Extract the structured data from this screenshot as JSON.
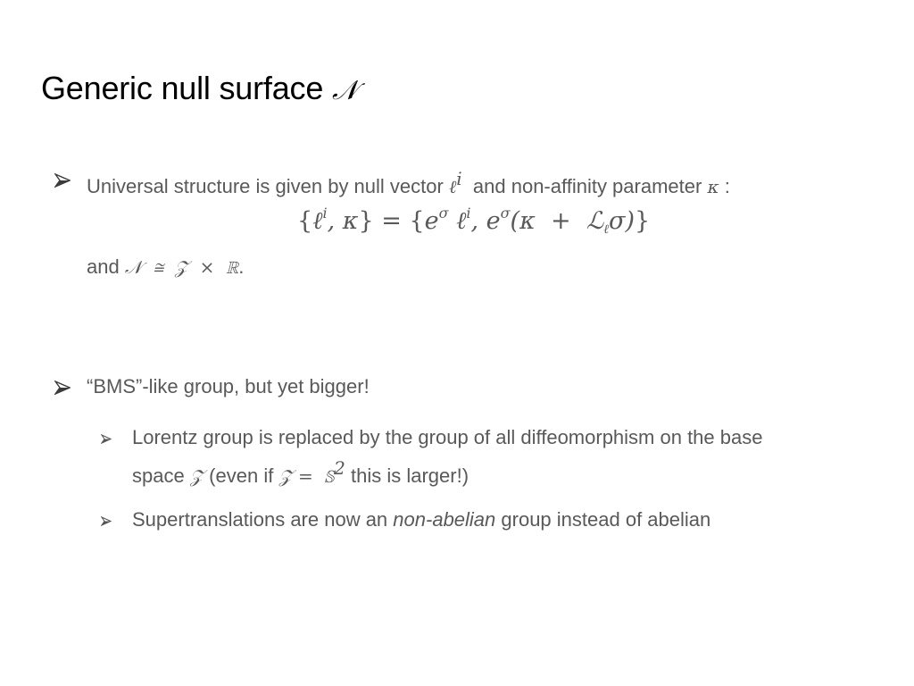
{
  "slide": {
    "title": {
      "text": "Generic null surface ",
      "symbol": "𝒩"
    },
    "bullets": [
      {
        "level": 1,
        "icon": "arrowhead-bullet-icon",
        "text_before": "Universal structure is given by null vector ",
        "sym_l": "ℓ",
        "sup_i": "i",
        "text_mid": "  and non-affinity parameter ",
        "sym_kappa": "κ",
        "text_after": " :"
      }
    ],
    "equation": {
      "lhs_open": "{",
      "lhs_l": "ℓ",
      "lhs_sup": "i",
      "lhs_rest": ", κ",
      "lhs_close": "}",
      "equals": " = ",
      "rhs_open": "{",
      "rhs_e1": "e",
      "rhs_sigma1": "σ",
      "rhs_l": " ℓ",
      "rhs_sup": "i",
      "rhs_comma": ", e",
      "rhs_sigma2": "σ",
      "rhs_paren": "(κ  +  ",
      "rhs_lie": "ℒ",
      "rhs_sub": "ℓ",
      "rhs_tail": "σ)",
      "rhs_close": "}"
    },
    "isomorphism": {
      "prefix": "and ",
      "expr": "𝒩  ≅  𝒵  ×  ℝ",
      "suffix": "."
    },
    "bms": {
      "icon": "arrowhead-bullet-icon",
      "text": "“BMS”-like group, but yet bigger!"
    },
    "sub_bullets": [
      {
        "icon": "small-arrowhead-bullet-icon",
        "line1": "Lorentz group is replaced by the group of all diffeomorphism on the base",
        "line2_prefix": "space ",
        "line2_sym_z": "𝒵",
        "line2_mid": " (even if ",
        "line2_eq": "𝒵 =  𝕊",
        "line2_sup": "2",
        "line2_suffix": " this is larger!)"
      },
      {
        "icon": "small-arrowhead-bullet-icon",
        "prefix": "Supertranslations are now an ",
        "emph": "non-abelian",
        "suffix": " group instead of abelian"
      }
    ]
  }
}
